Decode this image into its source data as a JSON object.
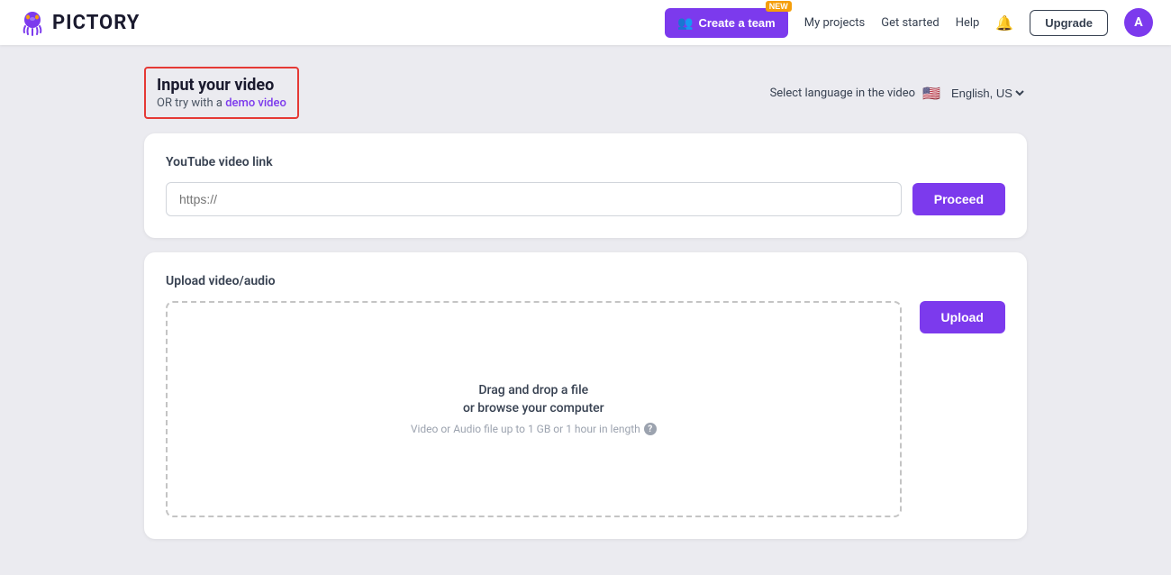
{
  "navbar": {
    "logo_text": "PICTORY",
    "create_team_label": "Create a team",
    "new_badge": "NEW",
    "my_projects_label": "My projects",
    "get_started_label": "Get started",
    "help_label": "Help",
    "upgrade_label": "Upgrade",
    "avatar_letter": "A"
  },
  "language_selector": {
    "label": "Select language in the video",
    "flag": "🇺🇸",
    "value": "English, US"
  },
  "input_video": {
    "title": "Input your video",
    "try_with_label": "OR try with a",
    "demo_link_label": "demo video"
  },
  "youtube_section": {
    "title": "YouTube video link",
    "input_placeholder": "https://",
    "proceed_label": "Proceed"
  },
  "upload_section": {
    "title": "Upload video/audio",
    "dropzone_line1": "Drag and drop a file",
    "dropzone_line2": "or browse your computer",
    "dropzone_hint": "Video or Audio file up to 1 GB or 1 hour in length",
    "upload_label": "Upload"
  }
}
